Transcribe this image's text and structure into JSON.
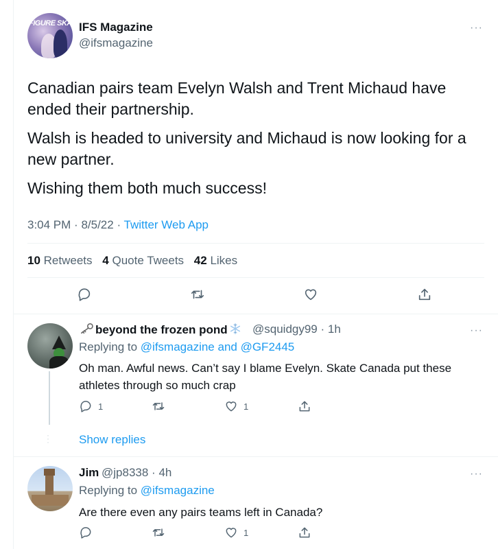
{
  "main_tweet": {
    "avatar_cover_text": "FIGURE SKATING",
    "display_name": "IFS Magazine",
    "handle": "@ifsmagazine",
    "paragraphs": [
      "Canadian pairs team Evelyn Walsh and Trent Michaud have ended their partnership.",
      "Walsh is headed to university and Michaud is now looking for a new partner.",
      "Wishing them both much success!"
    ],
    "time": "3:04 PM",
    "date": "8/5/22",
    "source": "Twitter Web App",
    "retweets_count": "10",
    "retweets_label": "Retweets",
    "quotes_count": "4",
    "quotes_label": "Quote Tweets",
    "likes_count": "42",
    "likes_label": "Likes",
    "more": "···"
  },
  "replies": [
    {
      "display_name": "beyond the frozen pond",
      "handle": "@squidgy99",
      "time": "1h",
      "replying_label": "Replying to",
      "replying_to": "@ifsmagazine and @GF2445",
      "text": "Oh man.  Awful news.  Can’t say I blame Evelyn. Skate Canada put these athletes through so much crap",
      "reply_count": "1",
      "retweet_count": "",
      "like_count": "1",
      "more": "···",
      "show_replies": "Show replies"
    },
    {
      "display_name": "Jim",
      "handle": "@jp8338",
      "time": "4h",
      "replying_label": "Replying to",
      "replying_to": "@ifsmagazine",
      "text": "Are there even any pairs teams left in Canada?",
      "reply_count": "",
      "retweet_count": "",
      "like_count": "1",
      "more": "···"
    }
  ],
  "colors": {
    "accent": "#1d9bf0",
    "text": "#0f1419",
    "secondary": "#536471",
    "divider": "#eff3f4"
  },
  "icons": [
    "reply-icon",
    "retweet-icon",
    "like-icon",
    "share-icon",
    "more-icon",
    "key-icon",
    "snowflake-icon"
  ]
}
